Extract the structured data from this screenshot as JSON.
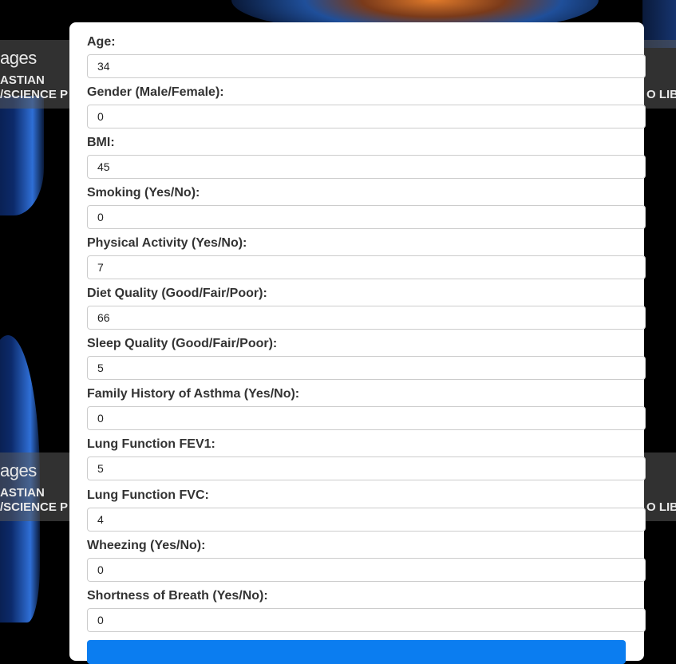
{
  "background": {
    "watermark_brand": "ages",
    "watermark_line1": "ASTIAN",
    "watermark_line2": "/SCIENCE P",
    "watermark_right": "O LIB"
  },
  "form": {
    "fields": [
      {
        "label": "Age:",
        "value": "34"
      },
      {
        "label": "Gender (Male/Female):",
        "value": "0"
      },
      {
        "label": "BMI:",
        "value": "45"
      },
      {
        "label": "Smoking (Yes/No):",
        "value": "0"
      },
      {
        "label": "Physical Activity (Yes/No):",
        "value": "7"
      },
      {
        "label": "Diet Quality (Good/Fair/Poor):",
        "value": "66"
      },
      {
        "label": "Sleep Quality (Good/Fair/Poor):",
        "value": "5"
      },
      {
        "label": "Family History of Asthma (Yes/No):",
        "value": "0"
      },
      {
        "label": "Lung Function FEV1:",
        "value": "5"
      },
      {
        "label": "Lung Function FVC:",
        "value": "4"
      },
      {
        "label": "Wheezing (Yes/No):",
        "value": "0"
      },
      {
        "label": "Shortness of Breath (Yes/No):",
        "value": "0"
      }
    ],
    "submit_label": ""
  },
  "colors": {
    "card_bg": "#ffffff",
    "label": "#333333",
    "submit_accent": "#0b7df0"
  }
}
